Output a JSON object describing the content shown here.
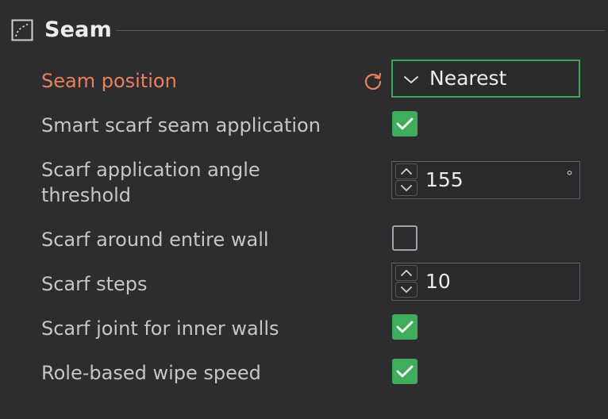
{
  "section": {
    "title": "Seam",
    "icon": "seam-icon"
  },
  "rows": {
    "seam_position": {
      "label": "Seam position",
      "value": "Nearest",
      "modified": true,
      "reset_icon": "reset-icon"
    },
    "smart_scarf": {
      "label": "Smart scarf seam application",
      "checked": true
    },
    "scarf_angle": {
      "label_line1": "Scarf application angle",
      "label_line2": "threshold",
      "value": "155",
      "unit": "°"
    },
    "scarf_around_wall": {
      "label": "Scarf around entire wall",
      "checked": false
    },
    "scarf_steps": {
      "label": "Scarf steps",
      "value": "10"
    },
    "scarf_inner_walls": {
      "label": "Scarf joint for inner walls",
      "checked": true
    },
    "role_wipe_speed": {
      "label": "Role-based wipe speed",
      "checked": true
    }
  },
  "colors": {
    "background": "#2d2d30",
    "accent_green": "#3fae5c",
    "modified_orange": "#e8805a"
  }
}
